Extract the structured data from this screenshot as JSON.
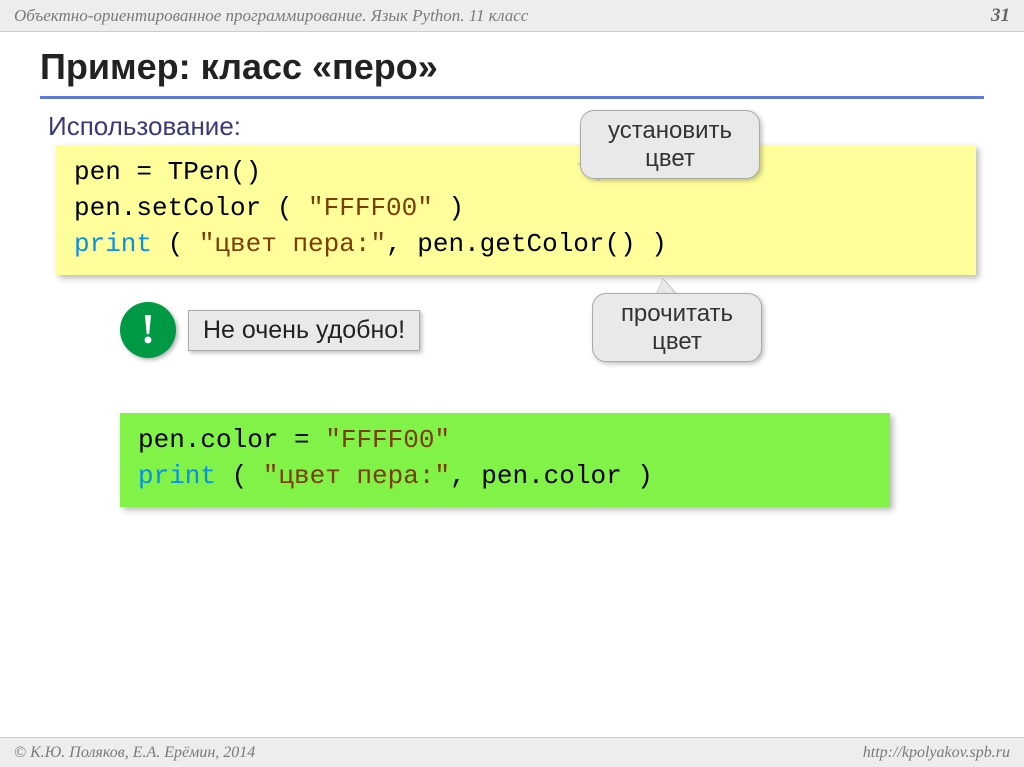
{
  "header": {
    "title": "Объектно-ориентированное программирование. Язык Python. 11 класс",
    "page_number": "31"
  },
  "slide": {
    "title": "Пример: класс «перо»",
    "subtitle": "Использование:"
  },
  "code1": {
    "l1a": "pen",
    "l1b": " = TPen()",
    "l2a": "pen.setColor ( ",
    "l2b": "\"FFFF00\"",
    "l2c": " )",
    "l3a": "print",
    "l3b": " ( ",
    "l3c": "\"цвет пера:\"",
    "l3d": ", pen.getColor() )"
  },
  "code2": {
    "l1a": "pen.color = ",
    "l1b": "\"FFFF00\"",
    "l2a": "print",
    "l2b": " ( ",
    "l2c": "\"цвет пера:\"",
    "l2d": ", pen.color )"
  },
  "callouts": {
    "set": "установить цвет",
    "read": "прочитать цвет"
  },
  "note": {
    "bang": "!",
    "text": "Не очень удобно!"
  },
  "footer": {
    "copyright": "© К.Ю. Поляков, Е.А. Ерёмин, 2014",
    "url": "http://kpolyakov.spb.ru"
  }
}
